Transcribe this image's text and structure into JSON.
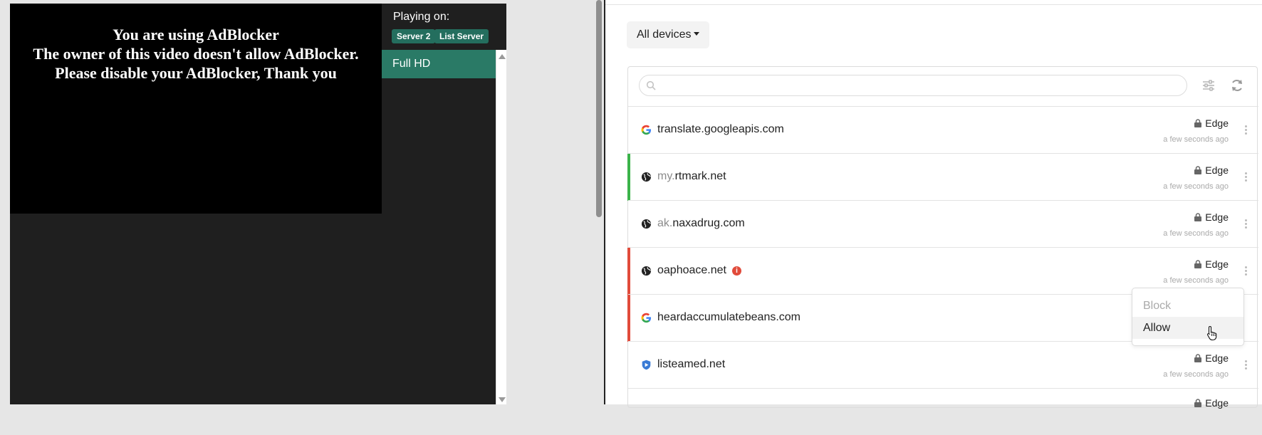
{
  "video_page": {
    "adblock_message": [
      "You are using AdBlocker",
      "The owner of this video doesn't allow AdBlocker.",
      "Please disable your AdBlocker, Thank you"
    ],
    "playing_on_label": "Playing on:",
    "servers": [
      "Server 2",
      "List Server"
    ],
    "quality_options": [
      "Full HD"
    ]
  },
  "log_page": {
    "device_filter_label": "All devices",
    "search": {
      "placeholder": ""
    },
    "rows": [
      {
        "icon": "google-icon",
        "subdomain": "",
        "domain": "translate.googleapis.com",
        "browser": "Edge",
        "time": "a few seconds ago",
        "status": "neutral",
        "alert": false
      },
      {
        "icon": "globe-icon",
        "subdomain": "my.",
        "domain": "rtmark.net",
        "browser": "Edge",
        "time": "a few seconds ago",
        "status": "allowed",
        "alert": false
      },
      {
        "icon": "globe-icon",
        "subdomain": "ak.",
        "domain": "naxadrug.com",
        "browser": "Edge",
        "time": "a few seconds ago",
        "status": "neutral",
        "alert": false
      },
      {
        "icon": "globe-icon",
        "subdomain": "",
        "domain": "oaphoace.net",
        "browser": "Edge",
        "time": "a few seconds ago",
        "status": "blocked",
        "alert": true
      },
      {
        "icon": "google-icon",
        "subdomain": "",
        "domain": "heardaccumulatebeans.com",
        "browser": "",
        "time": "",
        "status": "blocked",
        "alert": false
      },
      {
        "icon": "shield-play-icon",
        "subdomain": "",
        "domain": "listeamed.net",
        "browser": "Edge",
        "time": "a few seconds ago",
        "status": "neutral",
        "alert": false
      },
      {
        "icon": "globe-icon",
        "subdomain": "",
        "domain": "",
        "browser": "Edge",
        "time": "",
        "status": "neutral",
        "alert": false
      }
    ],
    "context_menu": {
      "block_label": "Block",
      "allow_label": "Allow"
    },
    "colors": {
      "allowed": "#3bb34a",
      "blocked": "#e14b3b",
      "server_badge": "#246e5e",
      "quality_active": "#2a7a66"
    }
  }
}
